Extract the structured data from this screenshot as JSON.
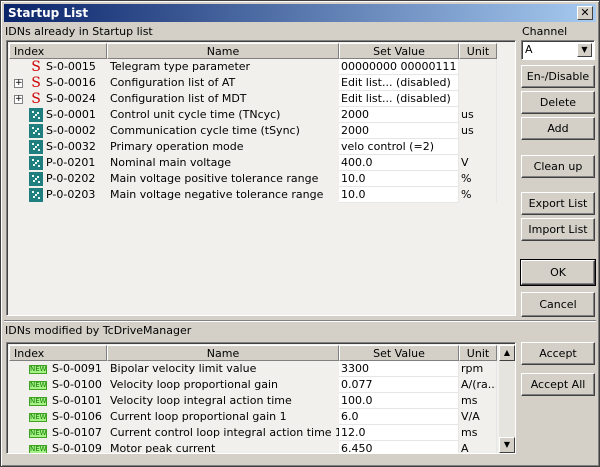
{
  "window": {
    "title": "Startup List",
    "close_glyph": "✕"
  },
  "startup": {
    "section_label": "IDNs already in Startup list",
    "columns": [
      "Index",
      "Name",
      "Set Value",
      "Unit"
    ],
    "rows": [
      {
        "expand": false,
        "icon": "s-parameter-icon",
        "id": "S-0-0015",
        "name": "Telegram type parameter",
        "value": "00000000 00000111",
        "unit": ""
      },
      {
        "expand": true,
        "icon": "s-parameter-icon",
        "id": "S-0-0016",
        "name": "Configuration list of AT",
        "value": "Edit list... (disabled)",
        "unit": ""
      },
      {
        "expand": true,
        "icon": "s-parameter-icon",
        "id": "S-0-0024",
        "name": "Configuration list of MDT",
        "value": "Edit list... (disabled)",
        "unit": ""
      },
      {
        "expand": false,
        "icon": "dots-icon",
        "id": "S-0-0001",
        "name": "Control unit cycle time (TNcyc)",
        "value": "2000",
        "unit": "us"
      },
      {
        "expand": false,
        "icon": "dots-icon",
        "id": "S-0-0002",
        "name": "Communication cycle time (tSync)",
        "value": "2000",
        "unit": "us"
      },
      {
        "expand": false,
        "icon": "dots-icon",
        "id": "S-0-0032",
        "name": "Primary operation mode",
        "value": "velo control (=2)",
        "unit": ""
      },
      {
        "expand": false,
        "icon": "dots-icon",
        "id": "P-0-0201",
        "name": "Nominal main voltage",
        "value": "400.0",
        "unit": "V"
      },
      {
        "expand": false,
        "icon": "dots-icon",
        "id": "P-0-0202",
        "name": "Main voltage positive tolerance range",
        "value": "10.0",
        "unit": "%"
      },
      {
        "expand": false,
        "icon": "dots-icon",
        "id": "P-0-0203",
        "name": "Main voltage negative tolerance range",
        "value": "10.0",
        "unit": "%"
      }
    ]
  },
  "channel": {
    "label": "Channel",
    "selected": "A"
  },
  "buttons": {
    "en_disable": "En-/Disable",
    "delete": "Delete",
    "add": "Add",
    "clean_up": "Clean up",
    "export_list": "Export List",
    "import_list": "Import List",
    "ok": "OK",
    "cancel": "Cancel",
    "accept": "Accept",
    "accept_all": "Accept All"
  },
  "modified": {
    "section_label": "IDNs modified by TcDriveManager",
    "columns": [
      "Index",
      "Name",
      "Set Value",
      "Unit"
    ],
    "new_badge": "NEW",
    "rows": [
      {
        "id": "S-0-0091",
        "name": "Bipolar velocity limit value",
        "value": "3300",
        "unit": "rpm"
      },
      {
        "id": "S-0-0100",
        "name": "Velocity loop proportional gain",
        "value": "0.077",
        "unit": "A/(ra..."
      },
      {
        "id": "S-0-0101",
        "name": "Velocity loop integral action time",
        "value": "100.0",
        "unit": "ms"
      },
      {
        "id": "S-0-0106",
        "name": "Current loop proportional gain 1",
        "value": "6.0",
        "unit": "V/A"
      },
      {
        "id": "S-0-0107",
        "name": "Current control loop integral action time 1",
        "value": "12.0",
        "unit": "ms"
      },
      {
        "id": "S-0-0109",
        "name": "Motor peak current",
        "value": "6.450",
        "unit": "A"
      }
    ]
  }
}
